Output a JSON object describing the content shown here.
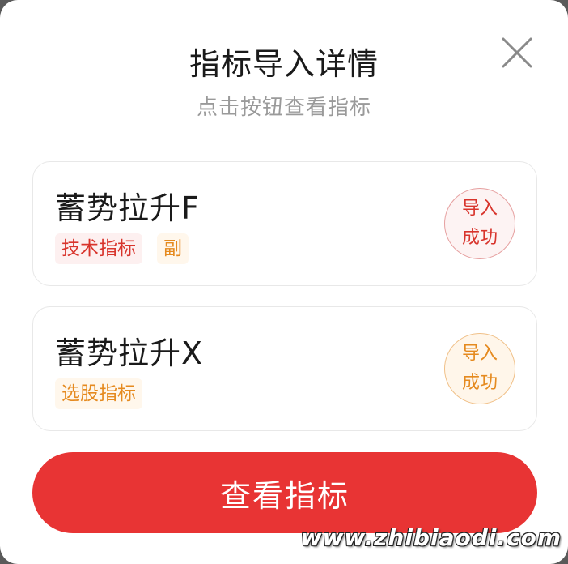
{
  "dialog": {
    "title": "指标导入详情",
    "subtitle": "点击按钮查看指标",
    "close_icon": "close-icon"
  },
  "indicators": [
    {
      "name": "蓄势拉升F",
      "tags": [
        {
          "label": "技术指标",
          "color": "#d8342c"
        },
        {
          "label": "副",
          "color": "#e58a1f"
        }
      ],
      "status_line1": "导入",
      "status_line2": "成功",
      "status_color": "#d8342c"
    },
    {
      "name": "蓄势拉升X",
      "tags": [
        {
          "label": "选股指标",
          "color": "#e58a1f"
        }
      ],
      "status_line1": "导入",
      "status_line2": "成功",
      "status_color": "#e58a1f"
    }
  ],
  "actions": {
    "view_label": "查看指标"
  },
  "watermark": "www.zhibiaodi.com",
  "colors": {
    "primary": "#e83434",
    "accent_orange": "#e58a1f"
  }
}
